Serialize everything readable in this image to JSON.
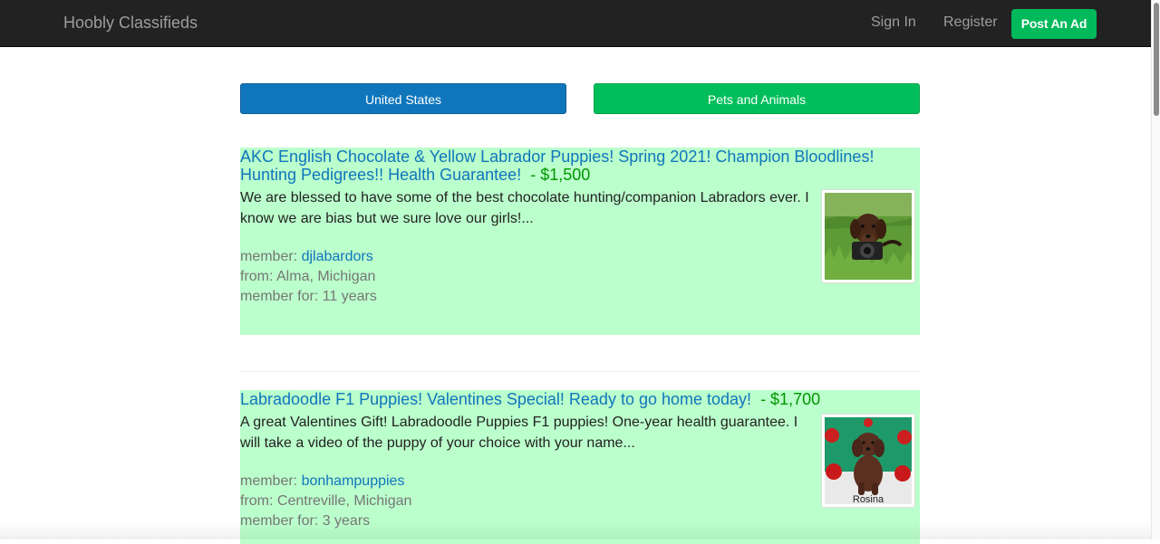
{
  "navbar": {
    "brand": "Hoobly Classifieds",
    "sign_in": "Sign In",
    "register": "Register",
    "post_ad": "Post An Ad"
  },
  "filters": {
    "country": "United States",
    "category": "Pets and Animals"
  },
  "listings": [
    {
      "title": "AKC English Chocolate & Yellow Labrador Puppies! Spring 2021! Champion Bloodlines! Hunting Pedigrees!! Health Guarantee!",
      "price": "- $1,500",
      "description": "We are blessed to have some of the best chocolate hunting/companion Labradors ever. I know we are bias but we sure love our girls!...",
      "member_label": "member: ",
      "member": "djlabardors",
      "from": "from: Alma, Michigan",
      "member_for": "member for: 11 years",
      "thumb_icon": "puppy-with-camera-photo"
    },
    {
      "title": "Labradoodle F1 Puppies! Valentines Special! Ready to go home today!",
      "price": "- $1,700",
      "description": "A great Valentines Gift! Labradoodle Puppies F1 puppies! One-year health guarantee. I will take a video of the puppy of your choice with your name...",
      "member_label": "member: ",
      "member": "bonhampuppies",
      "from": "from: Centreville, Michigan",
      "member_for": "member for: 3 years",
      "thumb_icon": "labradoodle-puppy-photo",
      "thumb_caption": "Rosina"
    }
  ],
  "colors": {
    "navbar_bg": "#222222",
    "post_ad": "#00b95a",
    "country_btn": "#0f76bc",
    "category_btn": "#00be5a",
    "listing_bg": "#bbffcc",
    "price": "#009600"
  }
}
